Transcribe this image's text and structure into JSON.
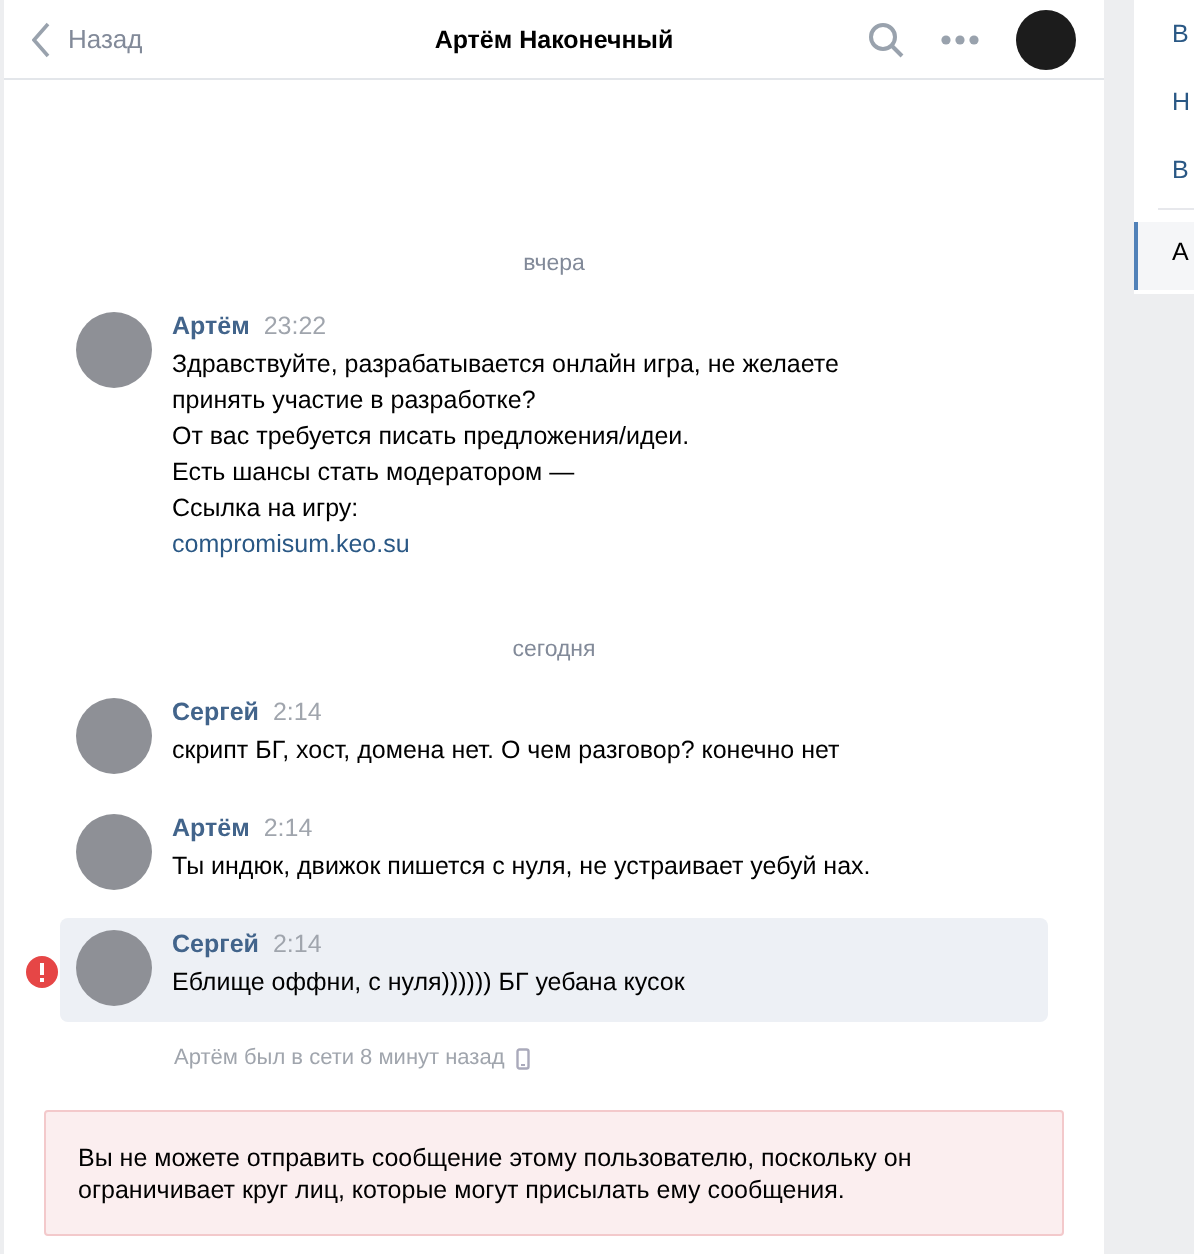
{
  "header": {
    "back": "Назад",
    "title": "Артём Наконечный"
  },
  "messages": [
    {
      "kind": "divider",
      "text": "вчера"
    },
    {
      "kind": "message",
      "author": "Артём",
      "time": "23:22",
      "selected": false,
      "failed": false,
      "lines": [
        "Здравствуйте, разрабатывается онлайн игра, не желаете принять участие в разработке?",
        "От вас требуется писать предложения/идеи.",
        "Есть шансы стать модератором —",
        "Ссылка на игру:"
      ],
      "link": "compromisum.keo.su"
    },
    {
      "kind": "divider",
      "text": "сегодня"
    },
    {
      "kind": "message",
      "author": "Сергей",
      "time": "2:14",
      "selected": false,
      "failed": false,
      "lines": [
        "скрипт БГ, хост, домена нет. О чем разговор? конечно нет"
      ]
    },
    {
      "kind": "message",
      "author": "Артём",
      "time": "2:14",
      "selected": false,
      "failed": false,
      "lines": [
        "Ты индюк, движок пишется с нуля, не устраивает уебуй нах."
      ]
    },
    {
      "kind": "message",
      "author": "Сергей",
      "time": "2:14",
      "selected": true,
      "failed": true,
      "lines": [
        "Еблище оффни, с нуля)))))) БГ уебана кусок"
      ]
    }
  ],
  "last_seen": "Артём был в сети 8 минут назад",
  "notice": "Вы не можете отправить сообщение этому пользователю, поскольку он ограничивает круг лиц, которые могут присылать ему сообщения.",
  "sidebar": {
    "items": [
      {
        "label": "В",
        "selected": false
      },
      {
        "label": "Н",
        "selected": false
      },
      {
        "label": "В",
        "selected": false
      },
      {
        "label": "А",
        "selected": true
      }
    ]
  }
}
